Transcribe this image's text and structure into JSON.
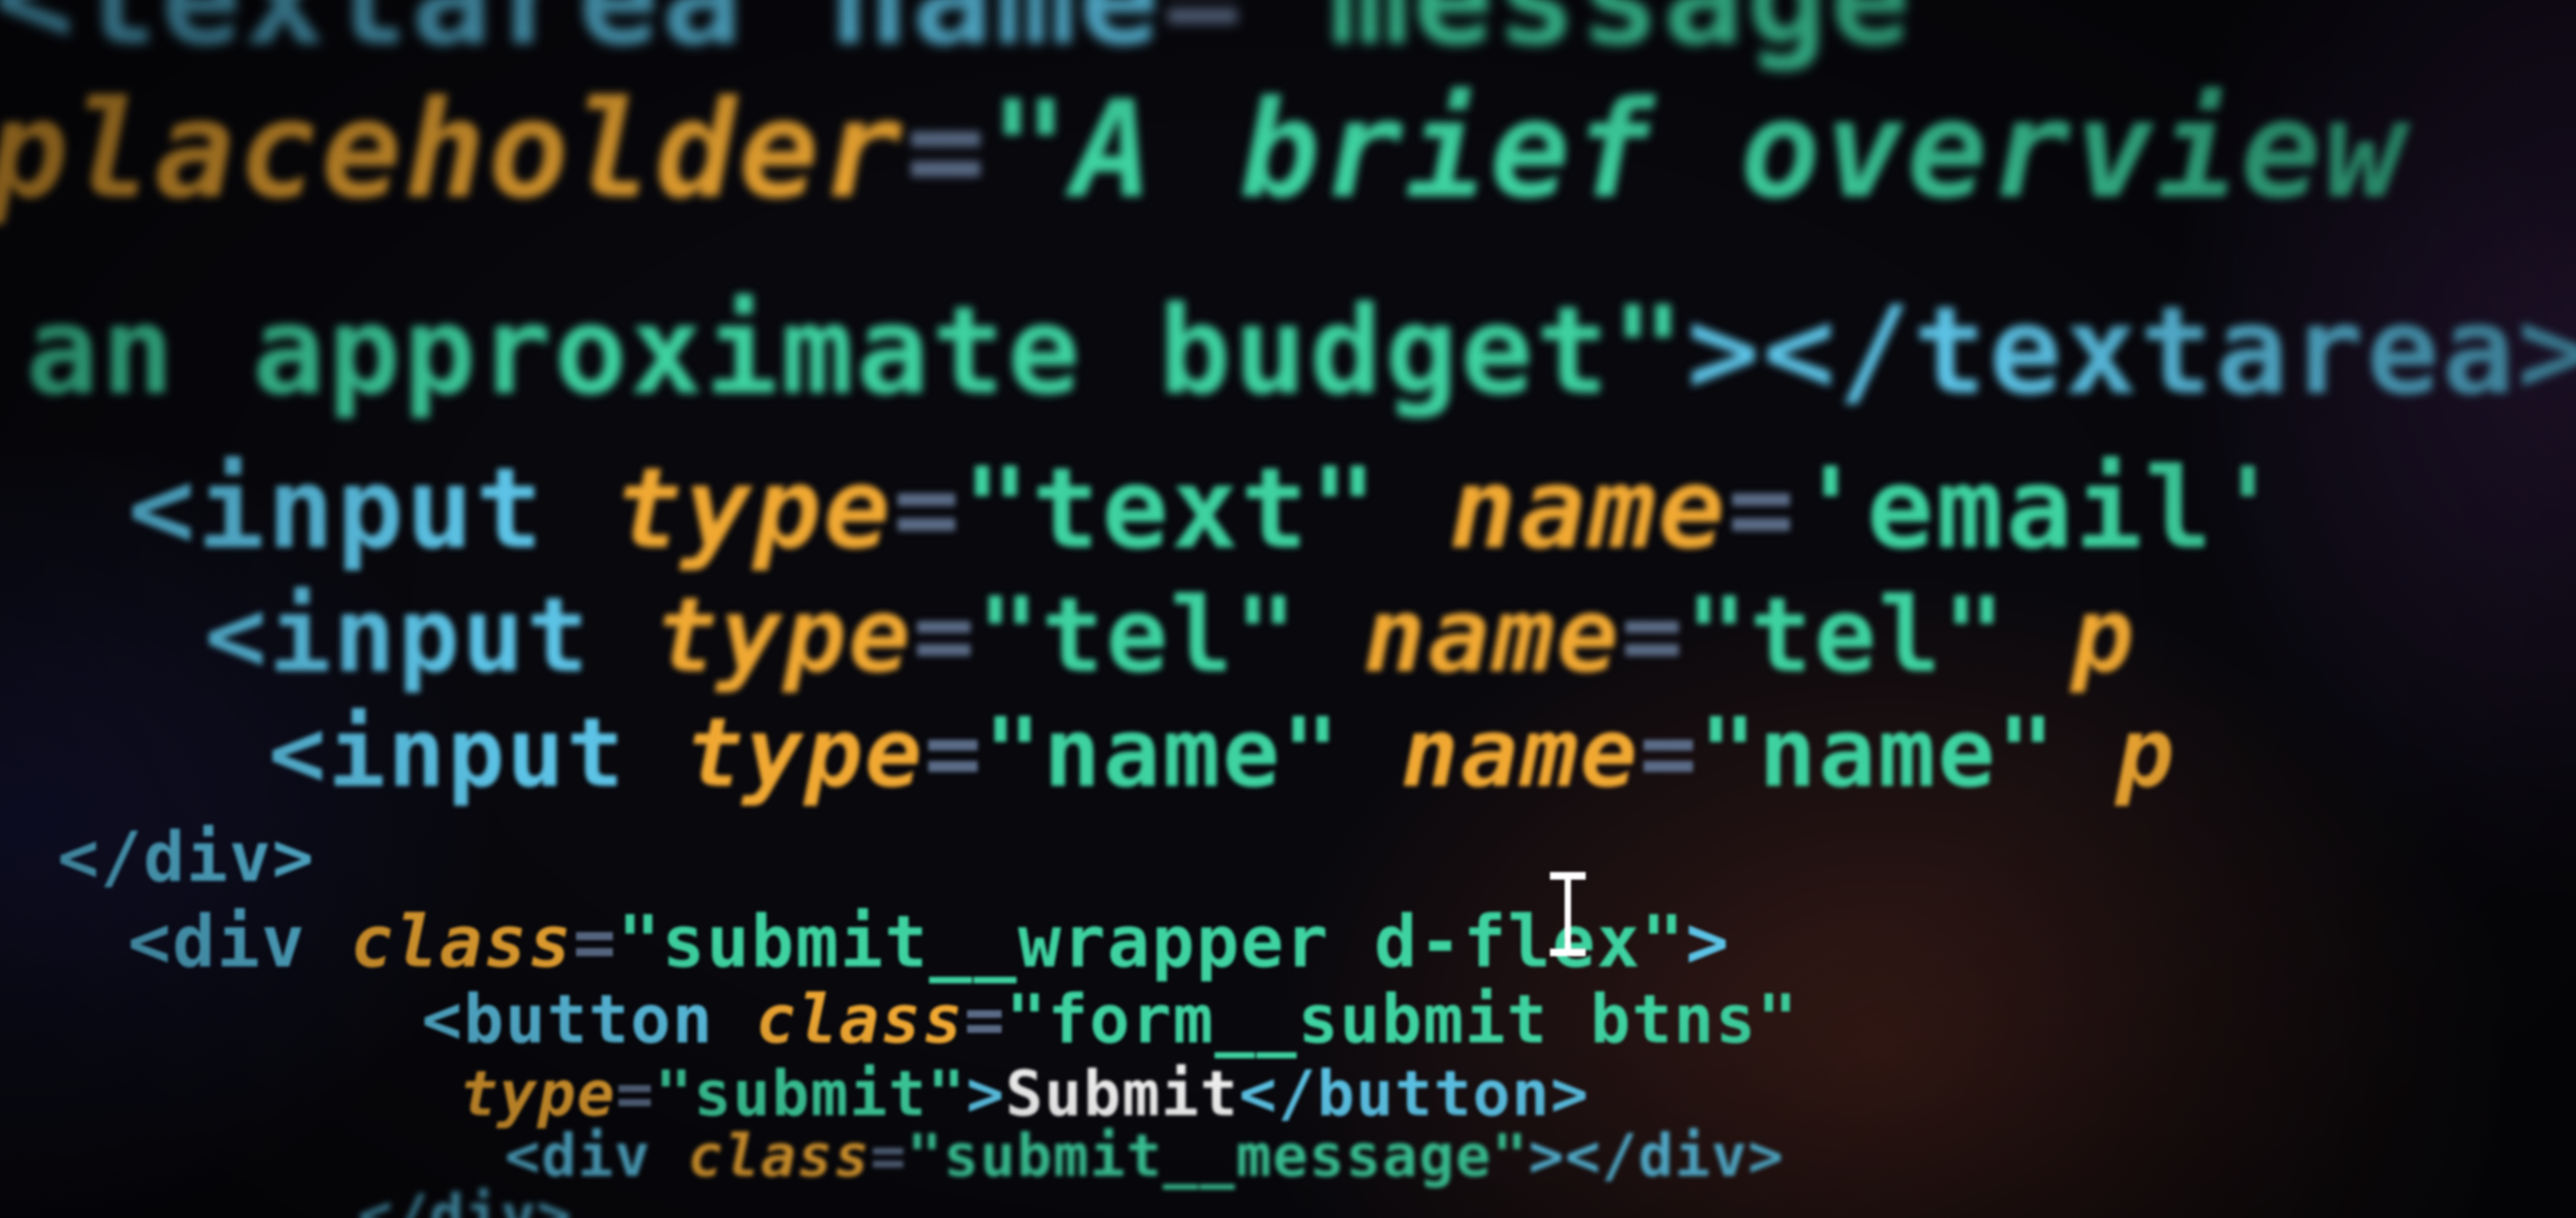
{
  "editor": {
    "lines": [
      {
        "tokens": [
          {
            "type": "tag",
            "text": "<textarea name"
          },
          {
            "type": "eq",
            "text": "="
          },
          {
            "type": "str",
            "text": "\"message\""
          }
        ]
      },
      {
        "tokens": [
          {
            "type": "attr",
            "text": "placeholder"
          },
          {
            "type": "eq",
            "text": "="
          },
          {
            "type": "str",
            "text": "\"A brief overview"
          }
        ]
      },
      {
        "tokens": [
          {
            "type": "str",
            "text": "an approximate budget\""
          },
          {
            "type": "tag",
            "text": "></textarea>"
          }
        ]
      },
      {
        "tokens": [
          {
            "type": "tag",
            "text": "<input "
          },
          {
            "type": "attr",
            "text": "type"
          },
          {
            "type": "eq",
            "text": "="
          },
          {
            "type": "str",
            "text": "\"text\" "
          },
          {
            "type": "attr",
            "text": "name"
          },
          {
            "type": "eq",
            "text": "="
          },
          {
            "type": "str",
            "text": "'email'"
          }
        ]
      },
      {
        "tokens": [
          {
            "type": "tag",
            "text": "<input "
          },
          {
            "type": "attr",
            "text": "type"
          },
          {
            "type": "eq",
            "text": "="
          },
          {
            "type": "str",
            "text": "\"tel\" "
          },
          {
            "type": "attr",
            "text": "name"
          },
          {
            "type": "eq",
            "text": "="
          },
          {
            "type": "str",
            "text": "\"tel\" "
          },
          {
            "type": "attr",
            "text": "p"
          }
        ]
      },
      {
        "tokens": [
          {
            "type": "tag",
            "text": "<input "
          },
          {
            "type": "attr",
            "text": "type"
          },
          {
            "type": "eq",
            "text": "="
          },
          {
            "type": "str",
            "text": "\"name\" "
          },
          {
            "type": "attr",
            "text": "name"
          },
          {
            "type": "eq",
            "text": "="
          },
          {
            "type": "str",
            "text": "\"name\""
          },
          {
            "type": "attr",
            "text": " p"
          }
        ]
      },
      {
        "tokens": [
          {
            "type": "tag",
            "text": "</div>"
          }
        ]
      },
      {
        "tokens": [
          {
            "type": "tag",
            "text": "<div "
          },
          {
            "type": "attr",
            "text": "class"
          },
          {
            "type": "eq",
            "text": "="
          },
          {
            "type": "str",
            "text": "\"submit__wrapper d-flex\""
          },
          {
            "type": "tag",
            "text": ">"
          }
        ]
      },
      {
        "tokens": [
          {
            "type": "tag",
            "text": "<button "
          },
          {
            "type": "attr",
            "text": "class"
          },
          {
            "type": "eq",
            "text": "="
          },
          {
            "type": "str",
            "text": "\"form__submit btns\""
          }
        ]
      },
      {
        "tokens": [
          {
            "type": "attr",
            "text": "type"
          },
          {
            "type": "eq",
            "text": "="
          },
          {
            "type": "str",
            "text": "\"submit\""
          },
          {
            "type": "tag",
            "text": ">"
          },
          {
            "type": "text",
            "text": "Submit"
          },
          {
            "type": "tag",
            "text": "</button>"
          }
        ]
      },
      {
        "tokens": [
          {
            "type": "tag",
            "text": "<div "
          },
          {
            "type": "attr",
            "text": "class"
          },
          {
            "type": "eq",
            "text": "="
          },
          {
            "type": "str",
            "text": "\"submit__message\""
          },
          {
            "type": "tag",
            "text": "></div>"
          }
        ]
      },
      {
        "tokens": [
          {
            "type": "tag",
            "text": "</div>"
          }
        ]
      }
    ]
  },
  "colors": {
    "tag": "#5cc3e6",
    "attribute": "#f0a832",
    "string": "#3ed2a0",
    "operator": "#5a6b86",
    "text": "#f2f2f2",
    "background": "#08080d"
  },
  "cursor": {
    "icon": "text-cursor-ibeam-icon"
  }
}
